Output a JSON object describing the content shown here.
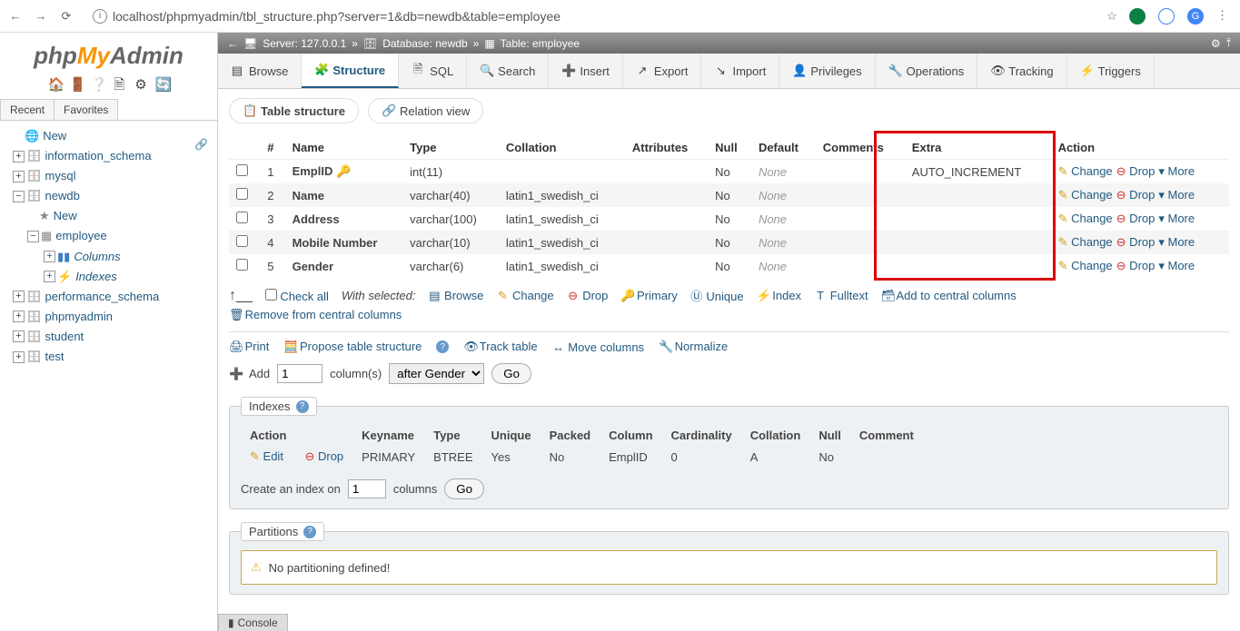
{
  "browser": {
    "url": "localhost/phpmyadmin/tbl_structure.php?server=1&db=newdb&table=employee"
  },
  "logo": {
    "p1": "php",
    "p2": "My",
    "p3": "Admin"
  },
  "sidebar_tabs": {
    "recent": "Recent",
    "favorites": "Favorites"
  },
  "tree": {
    "new": "New",
    "dbs": [
      "information_schema",
      "mysql",
      "newdb",
      "performance_schema",
      "phpmyadmin",
      "student",
      "test"
    ],
    "newdb_new": "New",
    "employee": "employee",
    "columns": "Columns",
    "indexes": "Indexes"
  },
  "breadcrumb": {
    "server": "Server: 127.0.0.1",
    "db": "Database: newdb",
    "table": "Table: employee"
  },
  "tabs": {
    "browse": "Browse",
    "structure": "Structure",
    "sql": "SQL",
    "search": "Search",
    "insert": "Insert",
    "export": "Export",
    "import": "Import",
    "privileges": "Privileges",
    "operations": "Operations",
    "tracking": "Tracking",
    "triggers": "Triggers"
  },
  "subtabs": {
    "tableStructure": "Table structure",
    "relationView": "Relation view"
  },
  "thead": {
    "num": "#",
    "name": "Name",
    "type": "Type",
    "collation": "Collation",
    "attributes": "Attributes",
    "null": "Null",
    "default": "Default",
    "comments": "Comments",
    "extra": "Extra",
    "action": "Action"
  },
  "rows": [
    {
      "n": "1",
      "name": "EmplID",
      "pk": true,
      "type": "int(11)",
      "coll": "",
      "null": "No",
      "def": "None",
      "extra": "AUTO_INCREMENT"
    },
    {
      "n": "2",
      "name": "Name",
      "pk": false,
      "type": "varchar(40)",
      "coll": "latin1_swedish_ci",
      "null": "No",
      "def": "None",
      "extra": ""
    },
    {
      "n": "3",
      "name": "Address",
      "pk": false,
      "type": "varchar(100)",
      "coll": "latin1_swedish_ci",
      "null": "No",
      "def": "None",
      "extra": ""
    },
    {
      "n": "4",
      "name": "Mobile Number",
      "pk": false,
      "type": "varchar(10)",
      "coll": "latin1_swedish_ci",
      "null": "No",
      "def": "None",
      "extra": ""
    },
    {
      "n": "5",
      "name": "Gender",
      "pk": false,
      "type": "varchar(6)",
      "coll": "latin1_swedish_ci",
      "null": "No",
      "def": "None",
      "extra": ""
    }
  ],
  "action_labels": {
    "change": "Change",
    "drop": "Drop",
    "more": "More"
  },
  "checkall": {
    "label": "Check all",
    "withsel": "With selected:",
    "browse": "Browse",
    "change": "Change",
    "drop": "Drop",
    "primary": "Primary",
    "unique": "Unique",
    "index": "Index",
    "fulltext": "Fulltext",
    "addCentral": "Add to central columns",
    "removeCentral": "Remove from central columns"
  },
  "tools": {
    "print": "Print",
    "propose": "Propose table structure",
    "track": "Track table",
    "move": "Move columns",
    "normalize": "Normalize"
  },
  "addcol": {
    "add": "Add",
    "count": "1",
    "cols": "column(s)",
    "after": "after Gender",
    "go": "Go"
  },
  "indexes": {
    "legend": "Indexes",
    "head": {
      "action": "Action",
      "keyname": "Keyname",
      "type": "Type",
      "unique": "Unique",
      "packed": "Packed",
      "column": "Column",
      "cardinality": "Cardinality",
      "collation": "Collation",
      "null": "Null",
      "comment": "Comment"
    },
    "row": {
      "edit": "Edit",
      "drop": "Drop",
      "keyname": "PRIMARY",
      "type": "BTREE",
      "unique": "Yes",
      "packed": "No",
      "column": "EmplID",
      "card": "0",
      "coll": "A",
      "null": "No",
      "comment": ""
    },
    "create1": "Create an index on",
    "create_n": "1",
    "create2": "columns",
    "go": "Go"
  },
  "partitions": {
    "legend": "Partitions",
    "msg": "No partitioning defined!"
  },
  "console": "Console"
}
